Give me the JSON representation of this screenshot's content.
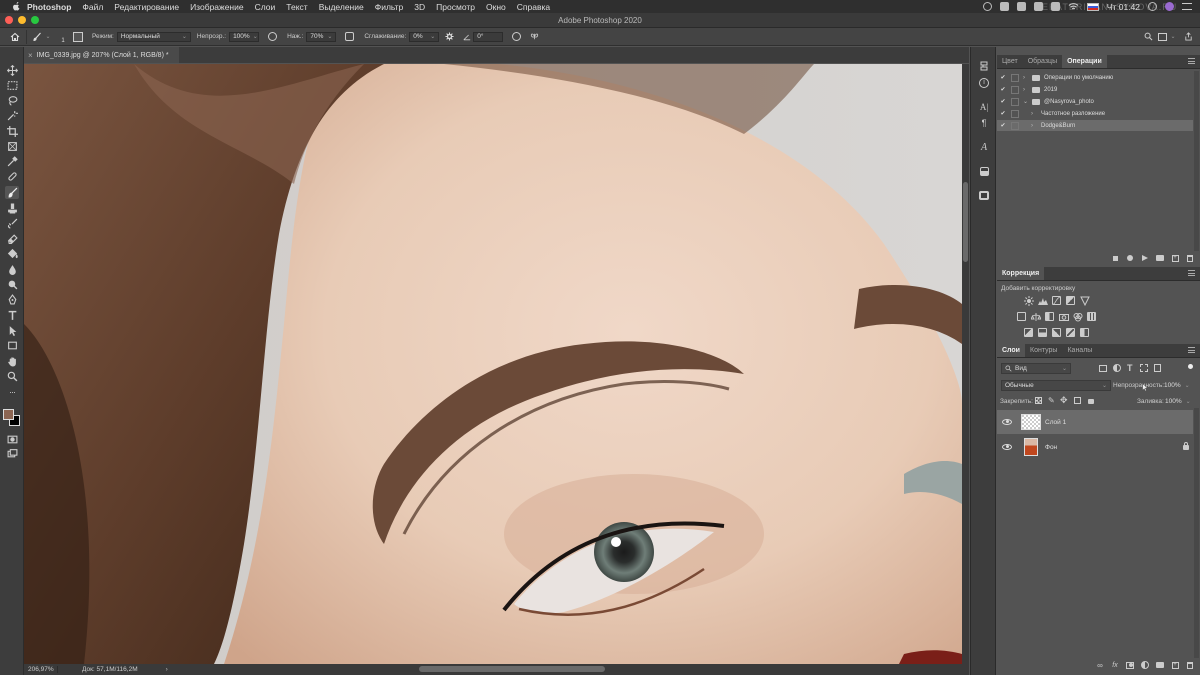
{
  "menubar": {
    "app": "Photoshop",
    "items": [
      "Файл",
      "Редактирование",
      "Изображение",
      "Слои",
      "Текст",
      "Выделение",
      "Фильтр",
      "3D",
      "Просмотр",
      "Окно",
      "Справка"
    ],
    "clock": "Чт 01:42",
    "watermark": "EKATERINANASYROVA.RU"
  },
  "window": {
    "title": "Adobe Photoshop 2020"
  },
  "options": {
    "brush_size": "1",
    "mode_label": "Режим:",
    "mode_value": "Нормальный",
    "opacity_label": "Непрозр.:",
    "opacity_value": "100%",
    "pressure_label": "Наж.:",
    "pressure_value": "70%",
    "smoothing_label": "Сглаживание:",
    "smoothing_value": "0%",
    "angle_value": "0°"
  },
  "document": {
    "tab_title": "IMG_0339.jpg @ 207% (Слой 1, RGB/8) *"
  },
  "status": {
    "zoom": "206,97%",
    "doc_size": "Док: 57,1M/116,2M"
  },
  "actions_panel": {
    "tabs": [
      "Цвет",
      "Образцы",
      "Операции"
    ],
    "active_tab": "Операции",
    "rows": [
      {
        "label": "Операции по умолчанию",
        "check": "✔",
        "folder": true,
        "indent": 0
      },
      {
        "label": "2019",
        "check": "✔",
        "folder": true,
        "indent": 0
      },
      {
        "label": "@Nasyrova_photo",
        "check": "✔",
        "folder": true,
        "indent": 0
      },
      {
        "label": "Частотное разложение",
        "check": "✔",
        "folder": false,
        "indent": 1
      },
      {
        "label": "Dodge&Burn",
        "check": "✔",
        "folder": false,
        "indent": 1
      }
    ]
  },
  "adjustments_panel": {
    "tab": "Коррекция",
    "subtitle": "Добавить корректировку"
  },
  "layers_panel": {
    "tabs": [
      "Слои",
      "Контуры",
      "Каналы"
    ],
    "active_tab": "Слои",
    "filter_value": "Вид",
    "blend_mode": "Обычные",
    "opacity_label": "Непрозрачность:",
    "opacity_value": "100%",
    "lock_label": "Закрепить:",
    "fill_label": "Заливка:",
    "fill_value": "100%",
    "layers": [
      {
        "name": "Слой 1",
        "selected": true
      },
      {
        "name": "Фон",
        "selected": false
      }
    ]
  },
  "colors": {
    "foreground": "#8c6552",
    "background": "#000000",
    "accent_selected": "#6b6b6b"
  }
}
